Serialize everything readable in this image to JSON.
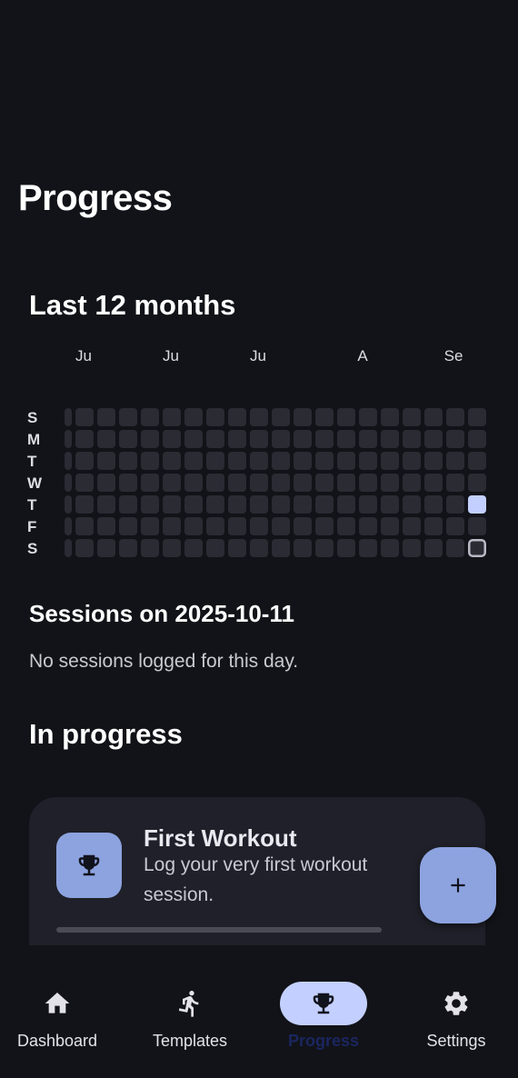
{
  "page": {
    "title": "Progress"
  },
  "heatmap": {
    "title": "Last 12 months",
    "months": [
      "Ju",
      "Ju",
      "Ju",
      "A",
      "Se"
    ],
    "days": [
      "S",
      "M",
      "T",
      "W",
      "T",
      "F",
      "S"
    ],
    "weeks": 20,
    "highlighted": [
      {
        "week": 19,
        "day": 4,
        "state": "logged"
      },
      {
        "week": 19,
        "day": 6,
        "state": "selected"
      }
    ],
    "colors": {
      "empty": "#2a2b33",
      "logged": "#c3d0ff",
      "selected_border": "#b8bac4"
    }
  },
  "sessions": {
    "title": "Sessions on 2025-10-11",
    "empty_message": "No sessions logged for this day."
  },
  "in_progress": {
    "title": "In progress",
    "cards": [
      {
        "icon": "trophy-icon",
        "title": "First Workout",
        "description": "Log your very first workout session.",
        "progress": 0
      }
    ]
  },
  "fab": {
    "icon": "plus-icon"
  },
  "nav": {
    "items": [
      {
        "label": "Dashboard",
        "icon": "home-icon",
        "active": false
      },
      {
        "label": "Templates",
        "icon": "running-icon",
        "active": false
      },
      {
        "label": "Progress",
        "icon": "trophy-icon",
        "active": true
      },
      {
        "label": "Settings",
        "icon": "gear-icon",
        "active": false
      }
    ]
  },
  "theme": {
    "background": "#121318",
    "accent": "#8da3e0",
    "accent_light": "#c3d0ff",
    "card": "#1f2029"
  }
}
